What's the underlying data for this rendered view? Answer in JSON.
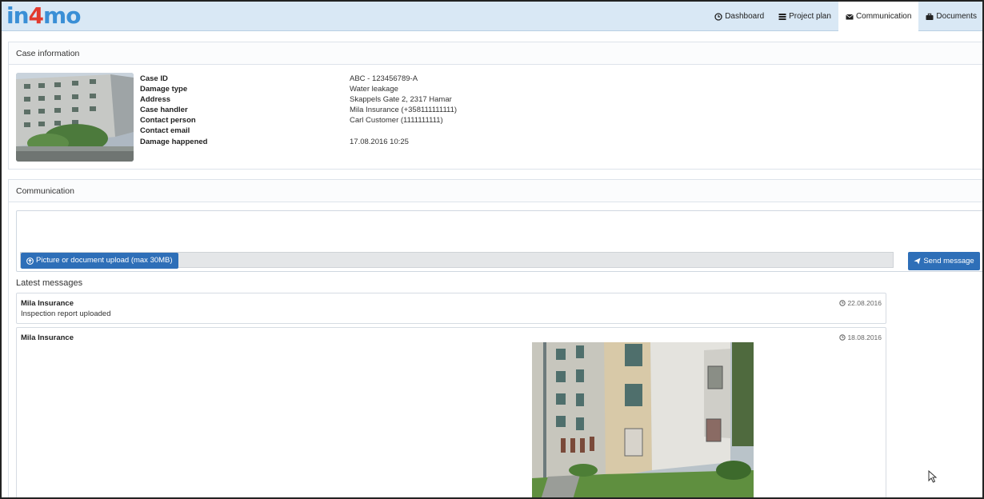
{
  "brand": {
    "logo_part1": "in",
    "logo_part2": "4",
    "logo_part3": "mo"
  },
  "nav": {
    "items": [
      {
        "label": "Dashboard",
        "icon": "clock-icon"
      },
      {
        "label": "Project plan",
        "icon": "list-icon"
      },
      {
        "label": "Communication",
        "icon": "envelope-icon",
        "active": true
      },
      {
        "label": "Documents",
        "icon": "briefcase-icon"
      }
    ]
  },
  "case_info": {
    "title": "Case information",
    "fields": [
      {
        "label": "Case ID",
        "value": "ABC - 123456789-A"
      },
      {
        "label": "Damage type",
        "value": "Water leakage"
      },
      {
        "label": "Address",
        "value": "Skappels Gate 2, 2317 Hamar"
      },
      {
        "label": "Case handler",
        "value": "Mila Insurance (+358111111111)"
      },
      {
        "label": "Contact person",
        "value": "Carl Customer (1111111111)"
      },
      {
        "label": "Contact email",
        "value": ""
      },
      {
        "label": "Damage happened",
        "value": "17.08.2016 10:25"
      }
    ]
  },
  "communication": {
    "title": "Communication",
    "message_value": "",
    "upload_label": "Picture or document upload (max 30MB)",
    "send_label": "Send message",
    "latest_title": "Latest messages",
    "messages": [
      {
        "author": "Mila Insurance",
        "text": "Inspection report uploaded",
        "date": "22.08.2016"
      },
      {
        "author": "Mila Insurance",
        "text": "",
        "date": "18.08.2016"
      }
    ]
  },
  "colors": {
    "topbar": "#d9e8f5",
    "primary_button": "#2e6fb8",
    "logo_blue": "#3a8fd6",
    "logo_red": "#e23a2e"
  }
}
